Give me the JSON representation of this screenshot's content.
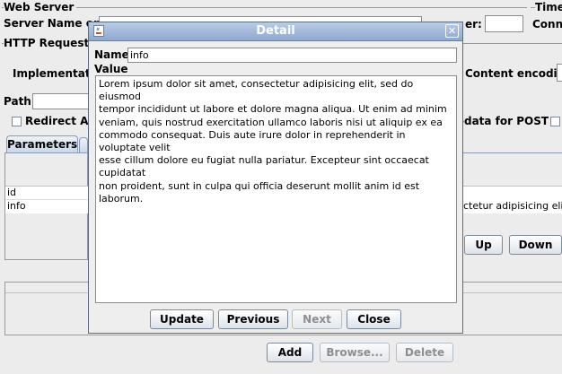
{
  "background": {
    "web_server_group": "Web Server",
    "timeouts_group": "Time",
    "server_name_label": "Server Name or IP",
    "port_number_label": "er:",
    "connect_label": "Conne",
    "http_request_group": "HTTP Request",
    "implementation_label": "Implementation",
    "content_encoding_label": "Content encoding:",
    "path_label": "Path:",
    "redirect_label": "Redirect Aut",
    "multipart_label": "-data for POST",
    "tabs": [
      {
        "label": "Parameters"
      }
    ],
    "params_rows": [
      {
        "name": "id",
        "value": ""
      },
      {
        "name": "info",
        "value": "ctetur adipisicing elit,"
      }
    ],
    "up_label": "Up",
    "down_label": "Down",
    "add_label": "Add",
    "browse_label": "Browse...",
    "delete_label": "Delete"
  },
  "dialog": {
    "title": "Detail",
    "close_glyph": "✕",
    "name_label": "Name:",
    "name_value": "info",
    "value_label": "Value",
    "value_text": "Lorem ipsum dolor sit amet, consectetur adipisicing elit, sed do eiusmod\ntempor incididunt ut labore et dolore magna aliqua. Ut enim ad minim\nveniam, quis nostrud exercitation ullamco laboris nisi ut aliquip ex ea\ncommodo consequat. Duis aute irure dolor in reprehenderit in voluptate velit\nesse cillum dolore eu fugiat nulla pariatur. Excepteur sint occaecat cupidatat\nnon proident, sunt in culpa qui officia deserunt mollit anim id est laborum.",
    "buttons": {
      "update": "Update",
      "previous": "Previous",
      "next": "Next",
      "close": "Close"
    }
  },
  "colors": {
    "title_bar": "#8ea8cf",
    "window_bg": "#ececec",
    "disabled_text": "#8e8e8e"
  },
  "icons": [
    "java-cup-icon",
    "close-icon"
  ]
}
